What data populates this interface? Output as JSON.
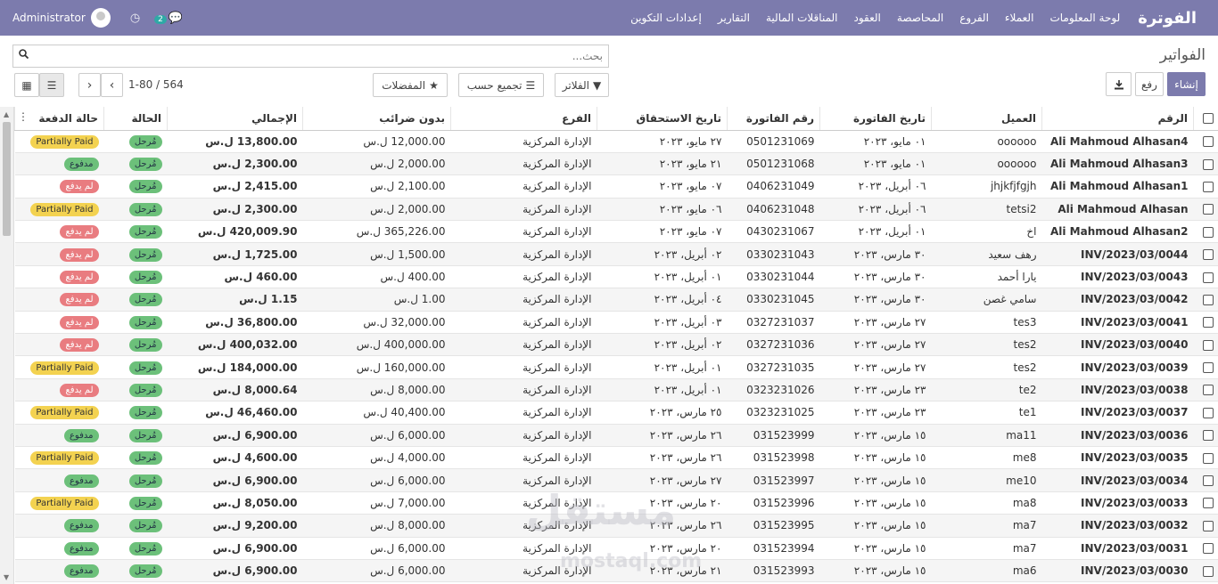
{
  "navbar": {
    "brand": "الفوترة",
    "menu": [
      "لوحة المعلومات",
      "العملاء",
      "الفروع",
      "المحاصصة",
      "العقود",
      "المناقلات المالية",
      "التقارير",
      "إعدادات التكوين"
    ],
    "user": "Administrator",
    "chat_count": "2"
  },
  "control_panel": {
    "breadcrumb": "الفواتير",
    "search_placeholder": "بحث...",
    "create_label": "إنشاء",
    "upload_label": "رفع",
    "filters_label": "الفلاتر",
    "groupby_label": "تجميع حسب",
    "favorites_label": "المفضلات",
    "pager_text": "1-80 / 564"
  },
  "table": {
    "headers": [
      "الرقم",
      "العميل",
      "تاريخ الفاتورة",
      "رقم الفاتورة",
      "تاريخ الاستحقاق",
      "الفرع",
      "بدون ضرائب",
      "الإجمالي",
      "الحالة",
      "حالة الدفعة"
    ],
    "rows": [
      [
        "Ali Mahmoud Alhasan4",
        "oooooo",
        "٠١ مايو، ٢٠٢٣",
        "0501231069",
        "٢٧ مايو، ٢٠٢٣",
        "الإدارة المركزية",
        "12,000.00 ل.س",
        "13,800.00 ل.س",
        "مُرحل",
        "Partially Paid"
      ],
      [
        "Ali Mahmoud Alhasan3",
        "oooooo",
        "٠١ مايو، ٢٠٢٣",
        "0501231068",
        "٢١ مايو، ٢٠٢٣",
        "الإدارة المركزية",
        "2,000.00 ل.س",
        "2,300.00 ل.س",
        "مُرحل",
        "مدفوع"
      ],
      [
        "Ali Mahmoud Alhasan1",
        "jhjkfjfgjh",
        "٠٦ أبريل، ٢٠٢٣",
        "0406231049",
        "٠٧ مايو، ٢٠٢٣",
        "الإدارة المركزية",
        "2,100.00 ل.س",
        "2,415.00 ل.س",
        "مُرحل",
        "لم يدفع"
      ],
      [
        "Ali Mahmoud Alhasan",
        "tetsi2",
        "٠٦ أبريل، ٢٠٢٣",
        "0406231048",
        "٠٦ مايو، ٢٠٢٣",
        "الإدارة المركزية",
        "2,000.00 ل.س",
        "2,300.00 ل.س",
        "مُرحل",
        "Partially Paid"
      ],
      [
        "Ali Mahmoud Alhasan2",
        "اخ",
        "٠١ أبريل، ٢٠٢٣",
        "0430231067",
        "٠٧ مايو، ٢٠٢٣",
        "الإدارة المركزية",
        "365,226.00 ل.س",
        "420,009.90 ل.س",
        "مُرحل",
        "لم يدفع"
      ],
      [
        "INV/2023/03/0044",
        "رهف سعيد",
        "٣٠ مارس، ٢٠٢٣",
        "0330231043",
        "٠٢ أبريل، ٢٠٢٣",
        "الإدارة المركزية",
        "1,500.00 ل.س",
        "1,725.00 ل.س",
        "مُرحل",
        "لم يدفع"
      ],
      [
        "INV/2023/03/0043",
        "يارا أحمد",
        "٣٠ مارس، ٢٠٢٣",
        "0330231044",
        "٠١ أبريل، ٢٠٢٣",
        "الإدارة المركزية",
        "400.00 ل.س",
        "460.00 ل.س",
        "مُرحل",
        "لم يدفع"
      ],
      [
        "INV/2023/03/0042",
        "سامي غصن",
        "٣٠ مارس، ٢٠٢٣",
        "0330231045",
        "٠٤ أبريل، ٢٠٢٣",
        "الإدارة المركزية",
        "1.00 ل.س",
        "1.15 ل.س",
        "مُرحل",
        "لم يدفع"
      ],
      [
        "INV/2023/03/0041",
        "tes3",
        "٢٧ مارس، ٢٠٢٣",
        "0327231037",
        "٠٣ أبريل، ٢٠٢٣",
        "الإدارة المركزية",
        "32,000.00 ل.س",
        "36,800.00 ل.س",
        "مُرحل",
        "لم يدفع"
      ],
      [
        "INV/2023/03/0040",
        "tes2",
        "٢٧ مارس، ٢٠٢٣",
        "0327231036",
        "٠٢ أبريل، ٢٠٢٣",
        "الإدارة المركزية",
        "400,000.00 ل.س",
        "400,032.00 ل.س",
        "مُرحل",
        "لم يدفع"
      ],
      [
        "INV/2023/03/0039",
        "tes2",
        "٢٧ مارس، ٢٠٢٣",
        "0327231035",
        "٠١ أبريل، ٢٠٢٣",
        "الإدارة المركزية",
        "160,000.00 ل.س",
        "184,000.00 ل.س",
        "مُرحل",
        "Partially Paid"
      ],
      [
        "INV/2023/03/0038",
        "te2",
        "٢٣ مارس، ٢٠٢٣",
        "0323231026",
        "٠١ أبريل، ٢٠٢٣",
        "الإدارة المركزية",
        "8,000.00 ل.س",
        "8,000.64 ل.س",
        "مُرحل",
        "لم يدفع"
      ],
      [
        "INV/2023/03/0037",
        "te1",
        "٢٣ مارس، ٢٠٢٣",
        "0323231025",
        "٢٥ مارس، ٢٠٢٣",
        "الإدارة المركزية",
        "40,400.00 ل.س",
        "46,460.00 ل.س",
        "مُرحل",
        "Partially Paid"
      ],
      [
        "INV/2023/03/0036",
        "ma11",
        "١٥ مارس، ٢٠٢٣",
        "031523999",
        "٢٦ مارس، ٢٠٢٣",
        "الإدارة المركزية",
        "6,000.00 ل.س",
        "6,900.00 ل.س",
        "مُرحل",
        "مدفوع"
      ],
      [
        "INV/2023/03/0035",
        "me8",
        "١٥ مارس، ٢٠٢٣",
        "031523998",
        "٢٦ مارس، ٢٠٢٣",
        "الإدارة المركزية",
        "4,000.00 ل.س",
        "4,600.00 ل.س",
        "مُرحل",
        "Partially Paid"
      ],
      [
        "INV/2023/03/0034",
        "me10",
        "١٥ مارس، ٢٠٢٣",
        "031523997",
        "٢٧ مارس، ٢٠٢٣",
        "الإدارة المركزية",
        "6,000.00 ل.س",
        "6,900.00 ل.س",
        "مُرحل",
        "مدفوع"
      ],
      [
        "INV/2023/03/0033",
        "ma8",
        "١٥ مارس، ٢٠٢٣",
        "031523996",
        "٢٠ مارس، ٢٠٢٣",
        "الإدارة المركزية",
        "7,000.00 ل.س",
        "8,050.00 ل.س",
        "مُرحل",
        "Partially Paid"
      ],
      [
        "INV/2023/03/0032",
        "ma7",
        "١٥ مارس، ٢٠٢٣",
        "031523995",
        "٢٦ مارس، ٢٠٢٣",
        "الإدارة المركزية",
        "8,000.00 ل.س",
        "9,200.00 ل.س",
        "مُرحل",
        "مدفوع"
      ],
      [
        "INV/2023/03/0031",
        "ma7",
        "١٥ مارس، ٢٠٢٣",
        "031523994",
        "٢٠ مارس، ٢٠٢٣",
        "الإدارة المركزية",
        "6,000.00 ل.س",
        "6,900.00 ل.س",
        "مُرحل",
        "مدفوع"
      ],
      [
        "INV/2023/03/0030",
        "ma6",
        "١٥ مارس، ٢٠٢٣",
        "031523993",
        "٢١ مارس، ٢٠٢٣",
        "الإدارة المركزية",
        "6,000.00 ل.س",
        "6,900.00 ل.س",
        "مُرحل",
        "مدفوع"
      ]
    ]
  },
  "watermark": {
    "text": "مستقل",
    "sub": "mostaql.com"
  },
  "colors": {
    "navbar": "#7c7bad",
    "posted": "#6cc07a",
    "partial": "#f3d250",
    "unpaid": "#e97c80"
  }
}
